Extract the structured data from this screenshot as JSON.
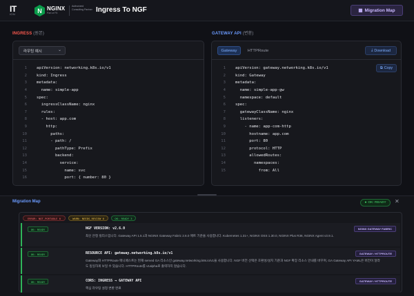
{
  "header": {
    "logo_it": "IT",
    "logo_it_sub": "ION",
    "nginx_name": "NGINX",
    "nginx_sub": "Part of F5",
    "partner_text": "Authorized Consulting Partner",
    "app_title": "Ingress To NGF",
    "migration_map_button": "Migration Map"
  },
  "ingress": {
    "label": "INGRESS",
    "label_paren": "(원본)",
    "select_value": "라우팅 예시",
    "code": [
      "apiVersion: networking.k8s.io/v1",
      "kind: Ingress",
      "metadata:",
      "  name: simple-app",
      "spec:",
      "  ingressClassName: nginx",
      "  rules:",
      "  - host: app.com",
      "    http:",
      "      paths:",
      "      - path: /",
      "        pathType: Prefix",
      "        backend:",
      "          service:",
      "            name: svc",
      "            port: { number: 80 }"
    ]
  },
  "gateway": {
    "label": "GATEWAY API",
    "label_paren": "(변환)",
    "tabs": [
      "Gateway",
      "HTTPRoute"
    ],
    "download_label": "Download",
    "copy_label": "Copy",
    "code": [
      "apiVersion: gateway.networking.k8s.io/v1",
      "kind: Gateway",
      "metadata:",
      "  name: simple-app-gw",
      "  namespace: default",
      "spec:",
      "  gatewayClassName: nginx",
      "  listeners:",
      "    - name: app-com-http",
      "      hostname: app.com",
      "      port: 80",
      "      protocol: HTTP",
      "      allowedRoutes:",
      "        namespaces:",
      "          from: All"
    ]
  },
  "migration_map": {
    "title": "Migration Map",
    "status_badge": "OK: READY",
    "pills": {
      "error": "ERROR: NOT_PORTABLE 0",
      "warn": "WARN: NEEDS_REVIEW 0",
      "ok": "OK: READY 3"
    },
    "rows": [
      {
        "status": "OK: READY",
        "title": "NGF VERSION: v2.6.0",
        "desc": "최신 안정 릴리스입니다. Gateway API 1.5.1과 NGINX Gateway Fabric 2.6.0 매트 기준을 사용합니다. Kubernetes 1.31+, NGINX OSS 1.30.0, NGINX Plus R36, NGINX Agent v3.9.1.",
        "tag": "NGINX GATEWAY FABRIC"
      },
      {
        "status": "OK: READY",
        "title": "RESOURCE API: gateway.networking.k8s.io/v1",
        "desc": "Gateway와 HTTPRoute 매니페스트는 현재 served GA 리소스인 gateway.networking.k8s.io/v1을 사용합니다. NGF 버전 선택은 호환성/설치 기준과 NGF 확장 리소스 안내를 바꾸며, GA Gateway API YAML은 버전이 달라도 동일하게 보일 수 있습니다. HTTPRoute를 v1alpha로 출력하지 않습니다.",
        "tag": "GATEWAY / HTTPROUTE"
      },
      {
        "status": "OK: READY",
        "title": "CORS: INGRESS → GATEWAY API",
        "desc": "핵심 라우팅 설정 변환 완료",
        "tag": "GATEWAY / HTTPROUTE"
      }
    ]
  },
  "colors": {
    "ingress_accent": "#ff5a4f",
    "gateway_accent": "#6b9bff",
    "ok_green": "#48d86e",
    "tag_purple": "#c9b8ff"
  }
}
